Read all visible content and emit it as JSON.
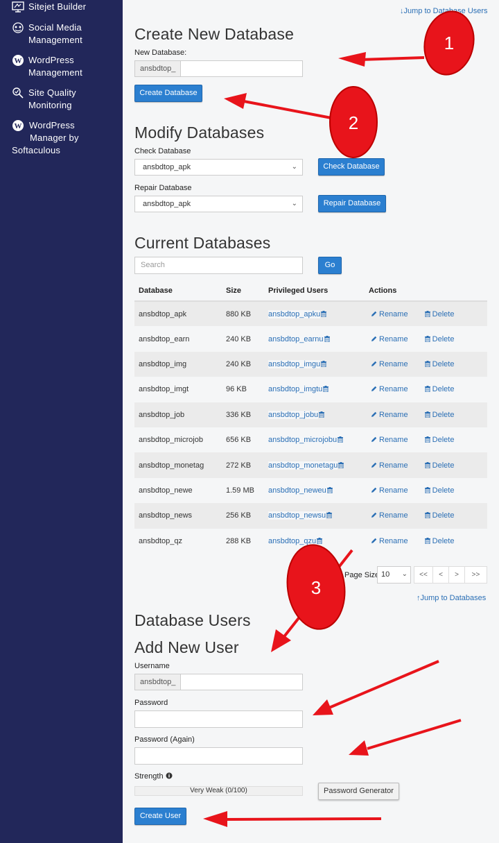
{
  "sidebar": {
    "items": [
      {
        "icon": "sitejet-icon",
        "lines": [
          "Sitejet Builder"
        ]
      },
      {
        "icon": "social-media-icon",
        "lines": [
          "Social Media",
          "Management"
        ]
      },
      {
        "icon": "wordpress-icon",
        "lines": [
          "WordPress",
          "Management"
        ]
      },
      {
        "icon": "site-quality-icon",
        "lines": [
          "Site Quality",
          "Monitoring"
        ]
      },
      {
        "icon": "wordpress-icon",
        "lines": [
          "WordPress",
          "Manager by",
          "Softaculous"
        ]
      }
    ]
  },
  "create": {
    "jump_link": "Jump to Database Users",
    "title": "Create New Database",
    "new_db_label": "New Database:",
    "prefix": "ansbdtop_",
    "button": "Create Database"
  },
  "modify": {
    "title": "Modify Databases",
    "check_label": "Check Database",
    "check_selected": "ansbdtop_apk",
    "check_button": "Check Database",
    "repair_label": "Repair Database",
    "repair_selected": "ansbdtop_apk",
    "repair_button": "Repair Database"
  },
  "current": {
    "title": "Current Databases",
    "search_placeholder": "Search",
    "go_button": "Go",
    "columns": [
      "Database",
      "Size",
      "Privileged Users",
      "Actions"
    ],
    "rename_label": "Rename",
    "delete_label": "Delete",
    "rows": [
      {
        "db": "ansbdtop_apk",
        "size": "880 KB",
        "user": "ansbdtop_apku"
      },
      {
        "db": "ansbdtop_earn",
        "size": "240 KB",
        "user": "ansbdtop_earnu"
      },
      {
        "db": "ansbdtop_img",
        "size": "240 KB",
        "user": "ansbdtop_imgu"
      },
      {
        "db": "ansbdtop_imgt",
        "size": "96 KB",
        "user": "ansbdtop_imgtu"
      },
      {
        "db": "ansbdtop_job",
        "size": "336 KB",
        "user": "ansbdtop_jobu"
      },
      {
        "db": "ansbdtop_microjob",
        "size": "656 KB",
        "user": "ansbdtop_microjobu"
      },
      {
        "db": "ansbdtop_monetag",
        "size": "272 KB",
        "user": "ansbdtop_monetagu"
      },
      {
        "db": "ansbdtop_newe",
        "size": "1.59 MB",
        "user": "ansbdtop_neweu"
      },
      {
        "db": "ansbdtop_news",
        "size": "256 KB",
        "user": "ansbdtop_newsu"
      },
      {
        "db": "ansbdtop_qz",
        "size": "288 KB",
        "user": "ansbdtop_qzu"
      }
    ],
    "page_size_label": "Page Size",
    "page_size_value": "10",
    "pager": [
      "<<",
      "<",
      ">",
      ">>"
    ],
    "jump_link": "Jump to Databases"
  },
  "users": {
    "title": "Database Users",
    "add_title": "Add New User",
    "username_label": "Username",
    "prefix": "ansbdtop_",
    "password_label": "Password",
    "password_again_label": "Password (Again)",
    "strength_label": "Strength",
    "strength_text": "Very Weak (0/100)",
    "strength_value": 0,
    "generator_button": "Password Generator",
    "create_button": "Create User"
  },
  "annotations": {
    "badges": [
      "1",
      "2",
      "3"
    ],
    "color": "#e8141b"
  }
}
